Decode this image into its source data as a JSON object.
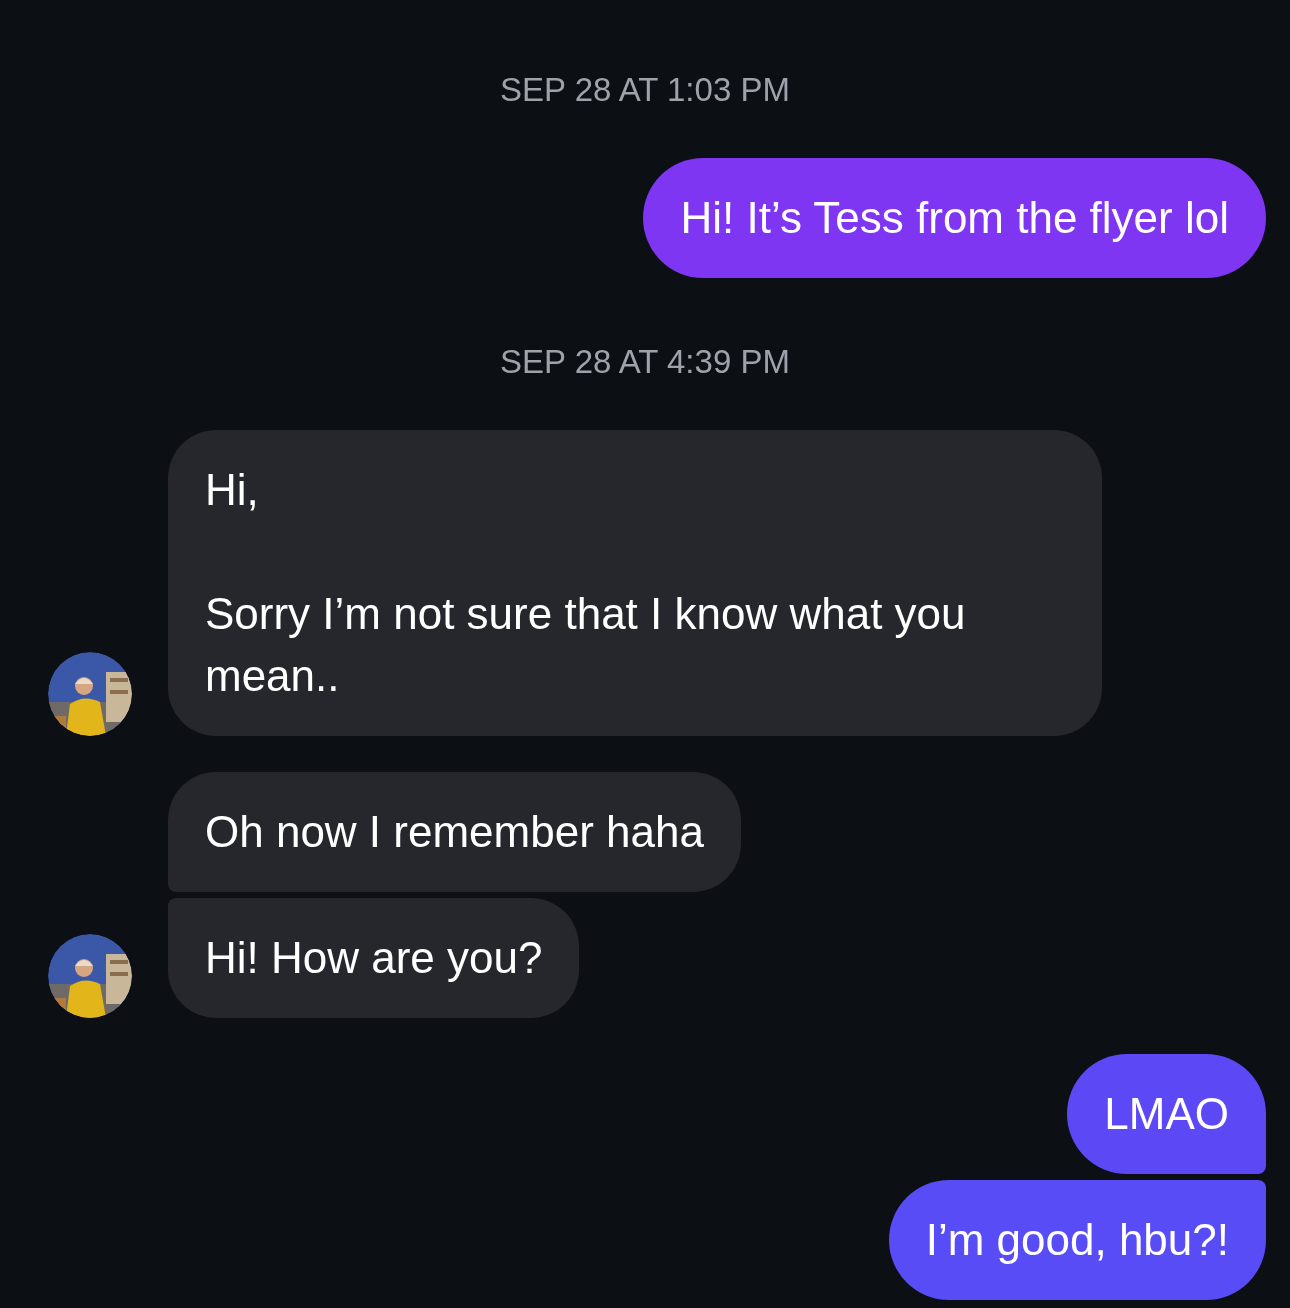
{
  "thread": [
    {
      "kind": "timestamp",
      "text": "SEP 28 AT 1:03 PM"
    },
    {
      "kind": "sent",
      "text": "Hi! It’s Tess from the flyer lol",
      "color": "#7f36f3",
      "grouped_with_next": false
    },
    {
      "kind": "timestamp",
      "text": "SEP 28 AT 4:39 PM"
    },
    {
      "kind": "received",
      "text": "Hi,\n\nSorry I’m not sure that I know what you mean..",
      "avatar": true,
      "grouped_with_next": false
    },
    {
      "kind": "received",
      "text": "Oh now I remember haha",
      "avatar": false,
      "grouped_with_next": true
    },
    {
      "kind": "received",
      "text": "Hi! How are you?",
      "avatar": true,
      "grouped_with_next": false
    },
    {
      "kind": "sent",
      "text": "LMAO",
      "color": "#5c49f5",
      "grouped_with_next": true
    },
    {
      "kind": "sent",
      "text": "I’m good, hbu?!",
      "color": "#584cf7",
      "grouped_with_next": false
    }
  ]
}
